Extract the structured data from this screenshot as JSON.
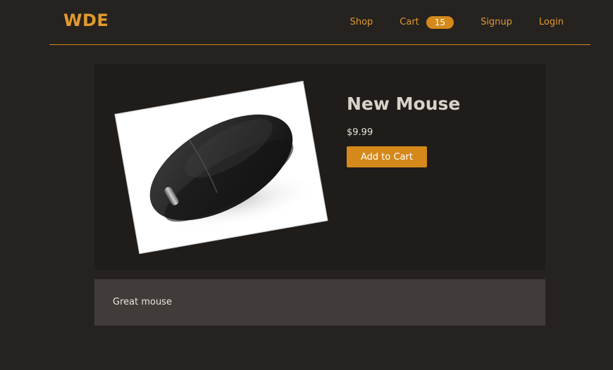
{
  "navbar": {
    "brand": "WDE",
    "links": {
      "shop": "Shop",
      "cart": "Cart",
      "cart_count": "15",
      "signup": "Signup",
      "login": "Login"
    },
    "accent_color": "#e29a2c"
  },
  "product": {
    "title": "New Mouse",
    "price": "$9.99",
    "add_to_cart_label": "Add to Cart",
    "image_subject": "black wireless computer mouse",
    "description": "Great mouse"
  },
  "colors": {
    "background": "#252220",
    "card": "#1f1c1a",
    "description_panel": "#413c39",
    "button": "#d4891a"
  }
}
